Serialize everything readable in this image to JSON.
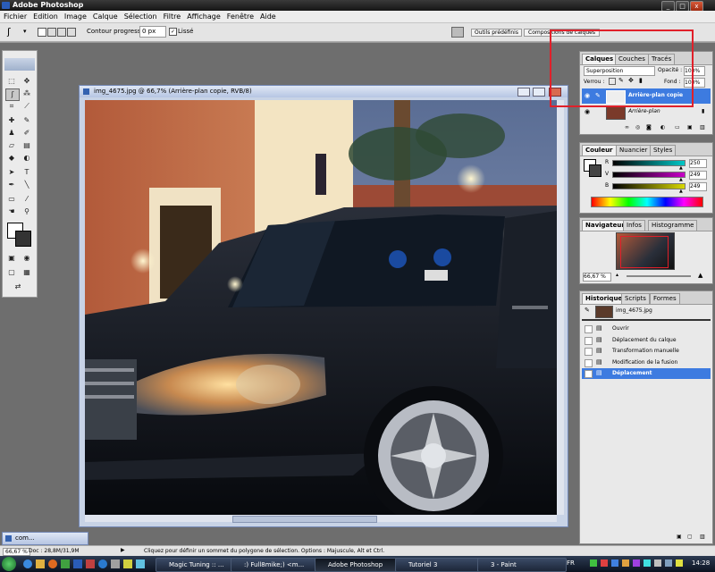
{
  "app": {
    "title": "Adobe Photoshop"
  },
  "menu": [
    "Fichier",
    "Edition",
    "Image",
    "Calque",
    "Sélection",
    "Filtre",
    "Affichage",
    "Fenêtre",
    "Aide"
  ],
  "options": {
    "feather_label": "Contour progressif :",
    "feather_value": "0 px",
    "smooth_label": "Lissé",
    "preset_button": "Outils prédéfinis",
    "comps_button": "Compositions de calques"
  },
  "document": {
    "title": "img_4675.jpg @ 66,7% (Arrière-plan copie, RVB/8)"
  },
  "layers_panel": {
    "tabs": [
      "Calques",
      "Couches",
      "Tracés"
    ],
    "blend_mode": "Superposition",
    "opacity_label": "Opacité :",
    "opacity_value": "100%",
    "lock_label": "Verrou :",
    "fill_label": "Fond :",
    "fill_value": "100%",
    "layers": [
      {
        "name": "Arrière-plan copie",
        "selected": true
      },
      {
        "name": "Arrière-plan",
        "selected": false
      }
    ]
  },
  "color_panel": {
    "tabs": [
      "Couleur",
      "Nuancier",
      "Styles"
    ],
    "channels": [
      {
        "label": "R",
        "value": "250",
        "fraction": 0.98,
        "color": "#00c8c8"
      },
      {
        "label": "V",
        "value": "249",
        "fraction": 0.976,
        "color": "#c800c8"
      },
      {
        "label": "B",
        "value": "249",
        "fraction": 0.976,
        "color": "#d8d800"
      }
    ]
  },
  "navigator_panel": {
    "tabs": [
      "Navigateur",
      "Infos",
      "Histogramme"
    ],
    "zoom": "66,67 %"
  },
  "history_panel": {
    "tabs": [
      "Historique",
      "Scripts",
      "Formes"
    ],
    "snapshot": "img_4675.jpg",
    "items": [
      {
        "name": "Ouvrir",
        "selected": false
      },
      {
        "name": "Déplacement du calque",
        "selected": false
      },
      {
        "name": "Transformation manuelle",
        "selected": false
      },
      {
        "name": "Modification de la fusion",
        "selected": false
      },
      {
        "name": "Déplacement",
        "selected": true
      }
    ]
  },
  "minimized_doc": "com...",
  "status": {
    "zoom": "66,67 %",
    "doc_info": "Doc : 28,8M/31,9M",
    "hint": "Cliquez pour définir un sommet du polygone de sélection. Options : Majuscule, Alt et Ctrl."
  },
  "taskbar": {
    "items": [
      {
        "label": "Magic Tuning :: ...",
        "active": false
      },
      {
        "label": ":) Full8mike;) <m...",
        "active": false
      },
      {
        "label": "Adobe Photoshop",
        "active": true
      },
      {
        "label": "Tutoriel 3",
        "active": false
      },
      {
        "label": "3 - Paint",
        "active": false
      }
    ],
    "lang": "FR",
    "clock": "14:28"
  },
  "colors": {
    "selection": "#3d7be0",
    "highlight_box": "#e0202a",
    "panel_bg": "#e9e9e9"
  }
}
